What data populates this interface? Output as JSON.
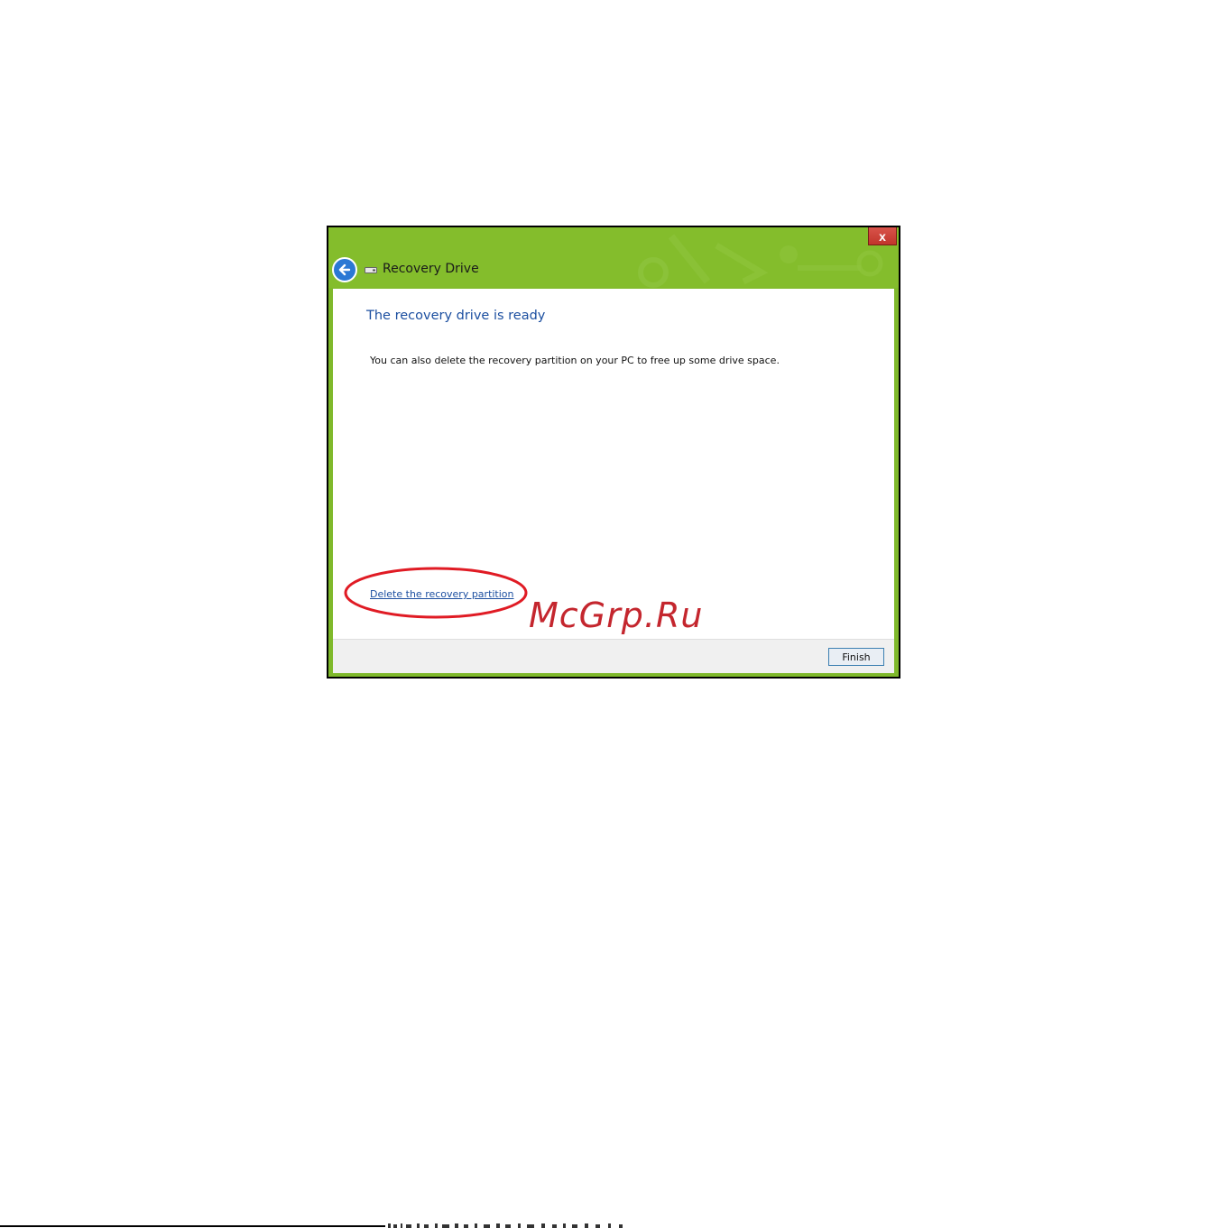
{
  "window": {
    "title": "Recovery Drive",
    "close_label": "x",
    "heading": "The recovery drive is ready",
    "description": "You can also delete the recovery partition on your PC to free up some drive space.",
    "delete_link": "Delete the recovery partition",
    "finish_label": "Finish",
    "colors": {
      "titlebar": "#84bd2c",
      "heading": "#1c4fa0",
      "close": "#c1362b"
    }
  },
  "icons": {
    "back": "back-arrow-icon",
    "drive": "drive-icon",
    "close": "close-icon"
  },
  "annotation": {
    "color": "#e01b24"
  },
  "watermark": {
    "text": "McGrp.Ru",
    "color": "#c4262e"
  }
}
